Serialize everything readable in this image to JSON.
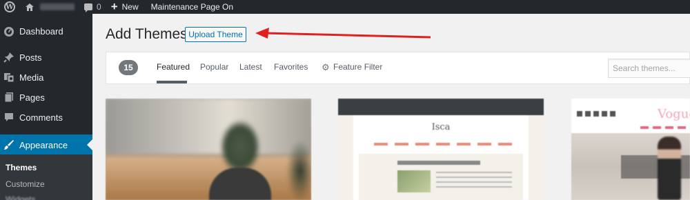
{
  "admin_bar": {
    "comments_count": "0",
    "new_label": "New",
    "maintenance_label": "Maintenance Page On"
  },
  "sidebar": {
    "items": [
      {
        "label": "Dashboard",
        "icon": "dashboard-icon"
      },
      {
        "label": "Posts",
        "icon": "pin-icon"
      },
      {
        "label": "Media",
        "icon": "media-icon"
      },
      {
        "label": "Pages",
        "icon": "pages-icon"
      },
      {
        "label": "Comments",
        "icon": "comment-icon"
      },
      {
        "label": "Appearance",
        "icon": "brush-icon",
        "active": true
      }
    ],
    "submenu": [
      {
        "label": "Themes",
        "current": true
      },
      {
        "label": "Customize"
      },
      {
        "label": "Widgets"
      }
    ]
  },
  "main": {
    "title": "Add Themes",
    "upload_button": "Upload Theme",
    "theme_count": "15",
    "filter_tabs": [
      "Featured",
      "Popular",
      "Latest",
      "Favorites"
    ],
    "feature_filter": "Feature Filter",
    "search_placeholder": "Search themes...",
    "card2_logo": "Isca",
    "card3_brand": "Vogue"
  },
  "colors": {
    "admin_bg": "#23282d",
    "accent": "#0073aa",
    "annotation_arrow": "#e02020"
  }
}
